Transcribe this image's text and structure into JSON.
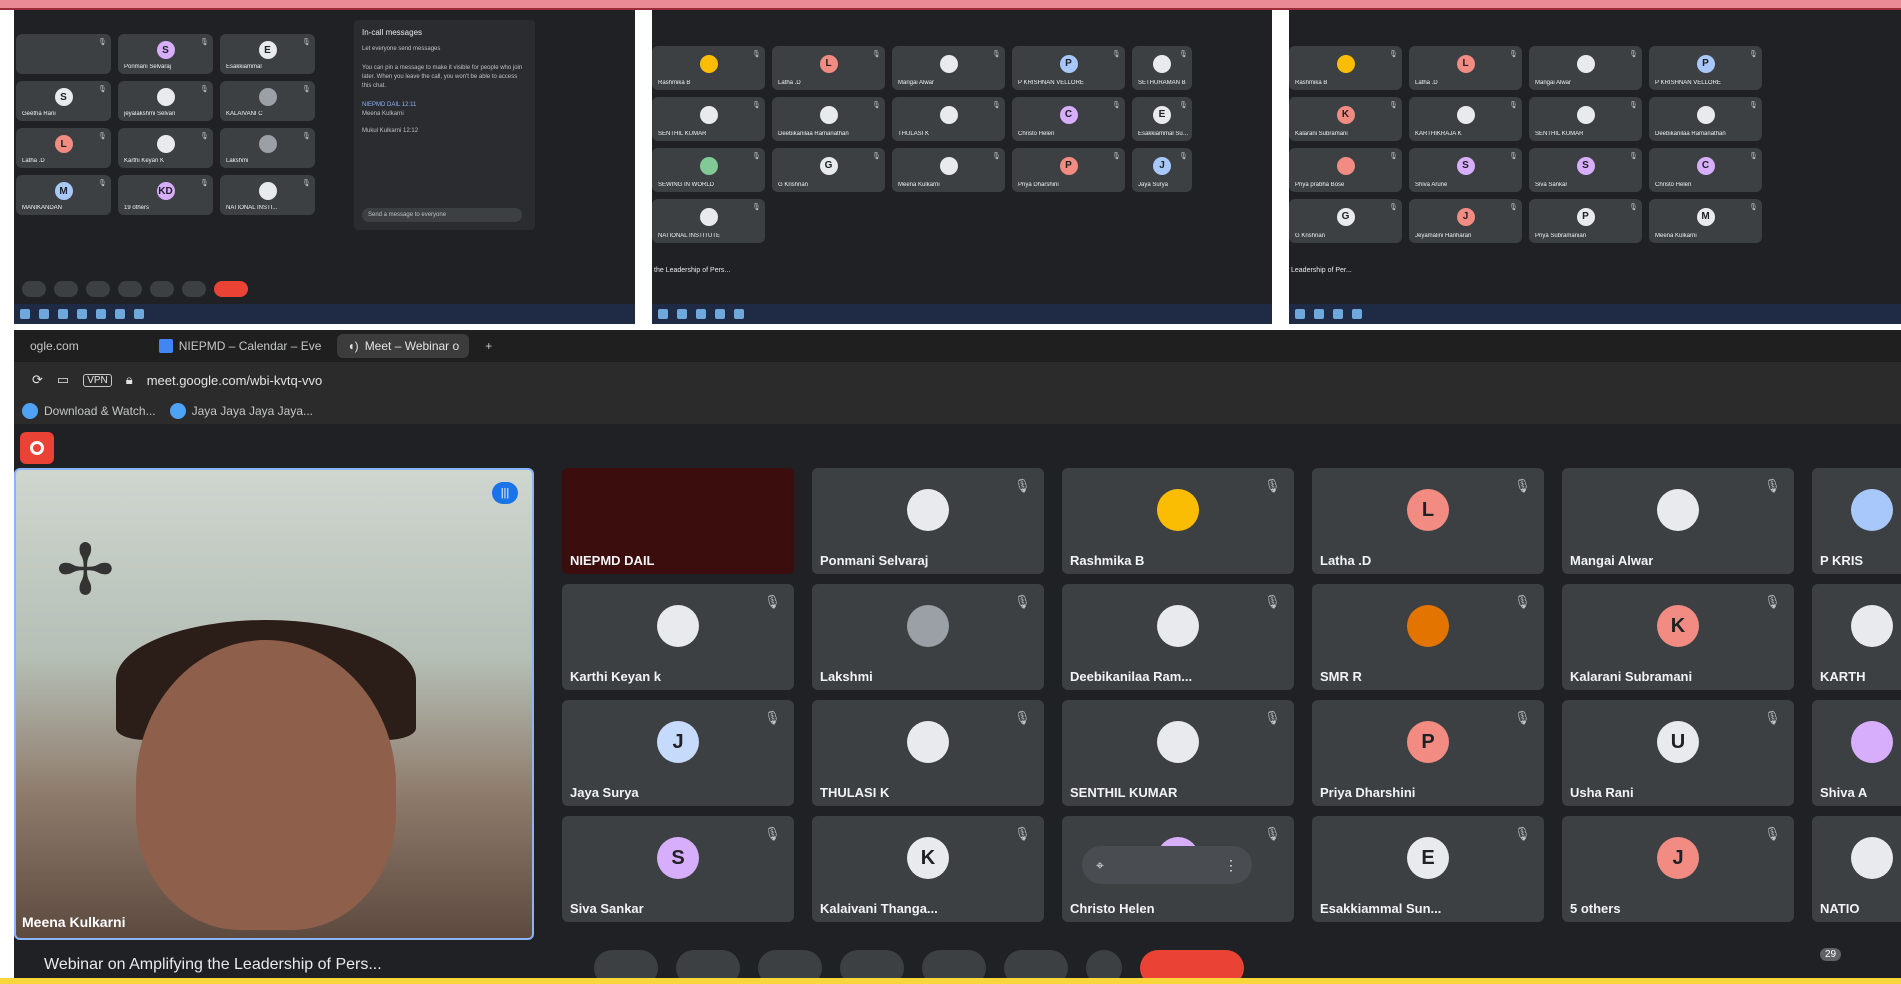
{
  "shots": {
    "chat": {
      "title": "In-call messages",
      "subtitle": "Let everyone send messages",
      "messages": [
        "You can pin a message to make it visible for people who join later. When you leave the call, you won't be able to access this chat.",
        "NIEPMD DAIL 12:11",
        "Meena Kulkarni",
        "Mukul Kulkarni 12:12"
      ],
      "input_placeholder": "Send a message to everyone"
    },
    "shot1_tiles": [
      {
        "name": "",
        "initial": ""
      },
      {
        "name": "Ponmani Selvaraj",
        "initial": "S",
        "color": "#d7aefb"
      },
      {
        "name": "Esakkiammal",
        "initial": "E",
        "color": "#e8eaed"
      },
      {
        "name": "Geetha Rani",
        "initial": "S",
        "color": "#e8eaed"
      },
      {
        "name": "jeyalakshmi Selvan",
        "initial": "",
        "color": "#e8eaed"
      },
      {
        "name": "KALAIVANI C",
        "initial": "",
        "color": "#9aa0a6"
      },
      {
        "name": "Latha .D",
        "initial": "L",
        "color": "#f28b82"
      },
      {
        "name": "Karthi Keyan K",
        "initial": "",
        "color": "#e8eaed"
      },
      {
        "name": "Lakshmi",
        "initial": "",
        "color": "#9aa0a6"
      },
      {
        "name": "MANIKANDAN",
        "initial": "M",
        "color": "#a8c7fa"
      },
      {
        "name": "19 others",
        "initial": "KD",
        "color": "#d7aefb"
      },
      {
        "name": "NATIONAL INSTI...",
        "initial": "",
        "color": "#e8eaed"
      }
    ],
    "shot2_tiles": [
      {
        "name": "Rashmika B",
        "initial": "",
        "color": "#fbbc04"
      },
      {
        "name": "Latha .D",
        "initial": "L",
        "color": "#f28b82"
      },
      {
        "name": "Mangai Alwar",
        "initial": "",
        "color": "#e8eaed"
      },
      {
        "name": "P KRISHNAN VELLORE",
        "initial": "P",
        "color": "#a8c7fa"
      },
      {
        "name": "SETHURAMAN B",
        "initial": "",
        "color": "#e8eaed"
      },
      {
        "name": "SENTHIL KUMAR",
        "initial": "",
        "color": "#e8eaed"
      },
      {
        "name": "Deebikanilaa Ramanathan",
        "initial": "",
        "color": "#e8eaed"
      },
      {
        "name": "THULASI K",
        "initial": "",
        "color": "#e8eaed"
      },
      {
        "name": "Christo Helen",
        "initial": "C",
        "color": "#d7aefb"
      },
      {
        "name": "Esakkiammal Sundar",
        "initial": "E",
        "color": "#e8eaed"
      },
      {
        "name": "SEWING IN WORLD",
        "initial": "",
        "color": "#81c995"
      },
      {
        "name": "G Krishnan",
        "initial": "G",
        "color": "#e8eaed"
      },
      {
        "name": "Meena Kulkarni",
        "initial": "",
        "color": "#e8eaed"
      },
      {
        "name": "Priya Dharshini",
        "initial": "P",
        "color": "#f28b82"
      },
      {
        "name": "Jaya Surya",
        "initial": "J",
        "color": "#a8c7fa"
      },
      {
        "name": "NATIONAL INSTITUTE",
        "initial": "",
        "color": "#e8eaed"
      }
    ],
    "shot3_tiles": [
      {
        "name": "Rashmika B",
        "initial": "",
        "color": "#fbbc04"
      },
      {
        "name": "Latha .D",
        "initial": "L",
        "color": "#f28b82"
      },
      {
        "name": "Mangai Alwar",
        "initial": "",
        "color": "#e8eaed"
      },
      {
        "name": "P KRISHNAN VELLORE",
        "initial": "P",
        "color": "#a8c7fa"
      },
      {
        "name": "Kalarani Subramani",
        "initial": "K",
        "color": "#f28b82"
      },
      {
        "name": "KARTHIKRAJA K",
        "initial": "",
        "color": "#e8eaed"
      },
      {
        "name": "SENTHIL KUMAR",
        "initial": "",
        "color": "#e8eaed"
      },
      {
        "name": "Deebikanilaa Ramanathan",
        "initial": "",
        "color": "#e8eaed"
      },
      {
        "name": "Priya prabha Bose",
        "initial": "",
        "color": "#f28b82"
      },
      {
        "name": "Shiva Arune",
        "initial": "S",
        "color": "#d7aefb"
      },
      {
        "name": "Siva Sankar",
        "initial": "S",
        "color": "#d7aefb"
      },
      {
        "name": "Christo Helen",
        "initial": "C",
        "color": "#d7aefb"
      },
      {
        "name": "G Krishnan",
        "initial": "G",
        "color": "#e8eaed"
      },
      {
        "name": "Jeyamalini Hariharan",
        "initial": "J",
        "color": "#f28b82"
      },
      {
        "name": "Priya Subramanian",
        "initial": "P",
        "color": "#e8eaed"
      },
      {
        "name": "Meena Kulkarni",
        "initial": "M",
        "color": "#e8eaed"
      }
    ],
    "mini_title": "the Leadership of Pers...",
    "mini_title3": "Leadership of Per..."
  },
  "browser": {
    "tab_partial": "ogle.com",
    "tab_calendar": "NIEPMD – Calendar – Eve",
    "tab_meet": "Meet – Webinar o",
    "tab_new": "+",
    "vpn": "VPN",
    "url": "meet.google.com/wbi-kvtq-vvo",
    "bookmarks": [
      "Download & Watch...",
      "Jaya Jaya Jaya Jaya..."
    ]
  },
  "meet": {
    "speaker_name": "Meena Kulkarni",
    "participants": [
      {
        "name": "NIEPMD DAIL",
        "initial": "",
        "color": "#3b0d0d",
        "dark": true
      },
      {
        "name": "Ponmani Selvaraj",
        "initial": "",
        "color": "#e8eaed"
      },
      {
        "name": "Rashmika B",
        "initial": "",
        "color": "#fbbc04"
      },
      {
        "name": "Latha .D",
        "initial": "L",
        "color": "#f28b82"
      },
      {
        "name": "Mangai Alwar",
        "initial": "",
        "color": "#e8eaed"
      },
      {
        "name": "P KRIS",
        "initial": "",
        "color": "#a8c7fa"
      },
      {
        "name": "Karthi Keyan k",
        "initial": "",
        "color": "#e8eaed"
      },
      {
        "name": "Lakshmi",
        "initial": "",
        "color": "#9aa0a6"
      },
      {
        "name": "Deebikanilaa Ram...",
        "initial": "",
        "color": "#e8eaed"
      },
      {
        "name": "SMR R",
        "initial": "",
        "color": "#e37400"
      },
      {
        "name": "Kalarani Subramani",
        "initial": "K",
        "color": "#f28b82"
      },
      {
        "name": "KARTH",
        "initial": "",
        "color": "#e8eaed"
      },
      {
        "name": "Jaya Surya",
        "initial": "J",
        "color": "#c6dafc"
      },
      {
        "name": "THULASI K",
        "initial": "",
        "color": "#e8eaed"
      },
      {
        "name": "SENTHIL KUMAR",
        "initial": "",
        "color": "#e8eaed"
      },
      {
        "name": "Priya Dharshini",
        "initial": "P",
        "color": "#f28b82"
      },
      {
        "name": "Usha Rani",
        "initial": "U",
        "color": "#e8eaed"
      },
      {
        "name": "Shiva A",
        "initial": "",
        "color": "#d7aefb"
      },
      {
        "name": "Siva Sankar",
        "initial": "S",
        "color": "#d7aefb"
      },
      {
        "name": "Kalaivani Thanga...",
        "initial": "K",
        "color": "#e8eaed"
      },
      {
        "name": "Christo Helen",
        "initial": "C",
        "color": "#d7aefb",
        "hover": true
      },
      {
        "name": "Esakkiammal Sun...",
        "initial": "E",
        "color": "#e8eaed"
      },
      {
        "name": "5 others",
        "initial": "J",
        "color": "#f28b82"
      },
      {
        "name": "NATIO",
        "initial": "",
        "color": "#e8eaed"
      }
    ],
    "hover_pin_icon": "pin-icon",
    "hover_more_icon": "more-vert-icon",
    "meeting_title": "Webinar on Amplifying the Leadership of Pers...",
    "participant_count": "29"
  }
}
